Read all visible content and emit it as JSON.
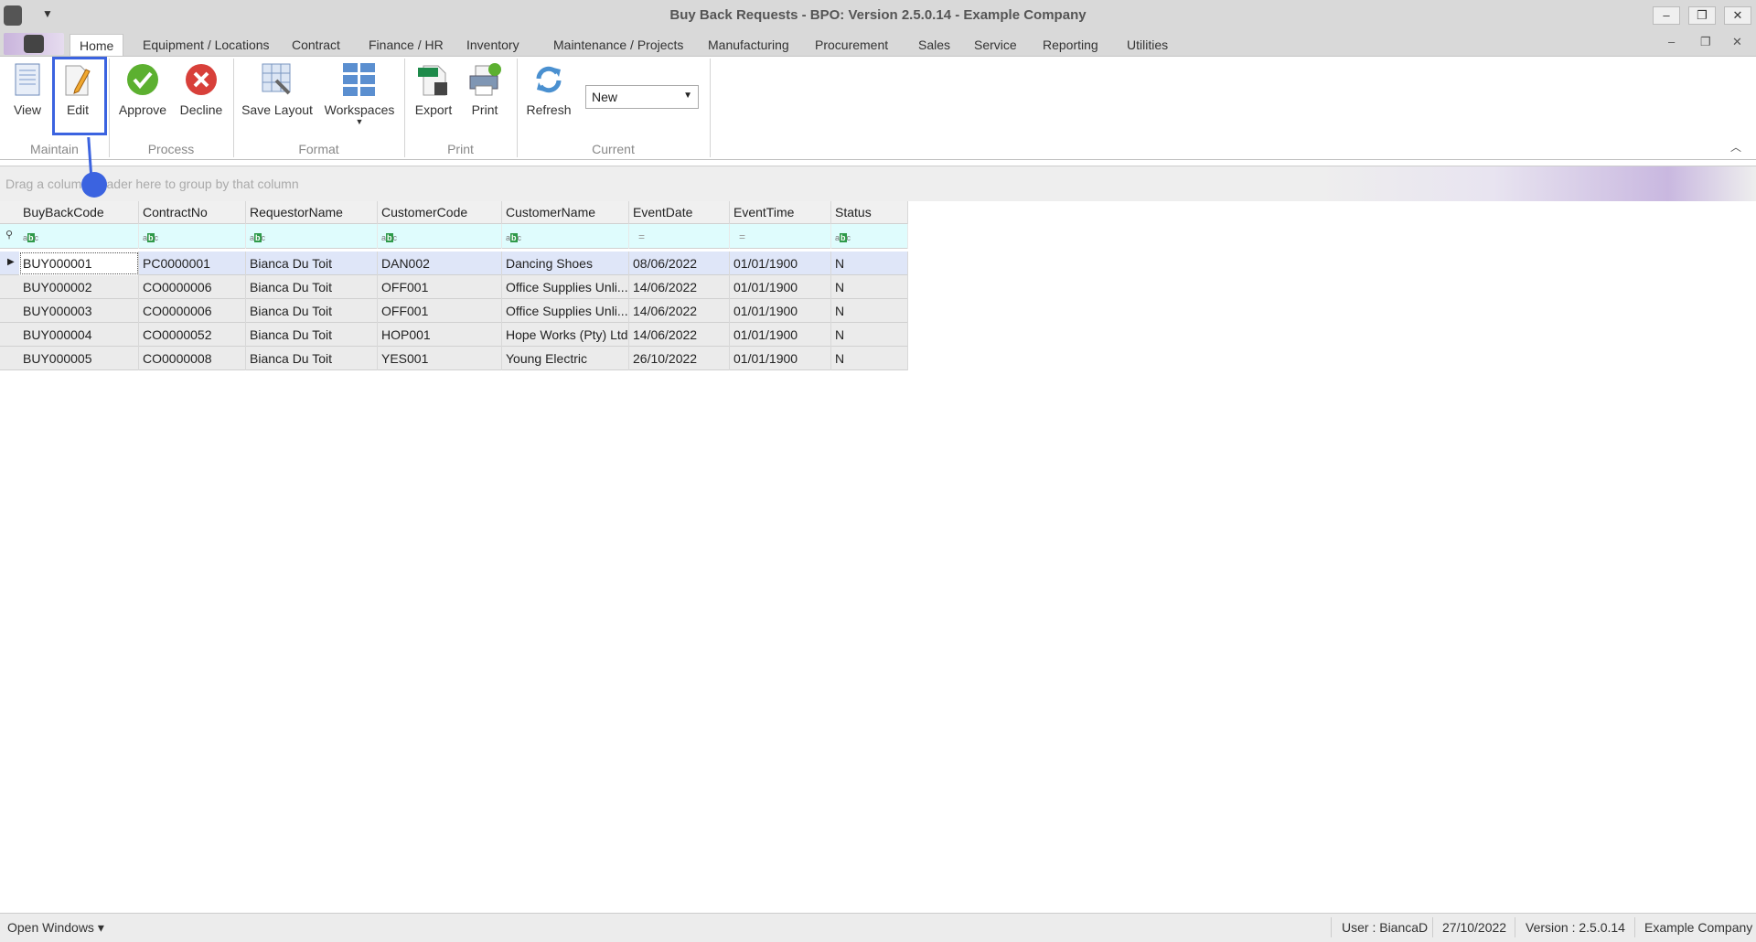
{
  "window": {
    "title": "Buy Back Requests - BPO: Version 2.5.0.14 - Example Company",
    "minimize": "–",
    "restore": "❐",
    "close": "✕"
  },
  "tabs": [
    {
      "label": "Home",
      "active": true
    },
    {
      "label": "Equipment / Locations"
    },
    {
      "label": "Contract"
    },
    {
      "label": "Finance / HR"
    },
    {
      "label": "Inventory"
    },
    {
      "label": "Maintenance / Projects"
    },
    {
      "label": "Manufacturing"
    },
    {
      "label": "Procurement"
    },
    {
      "label": "Sales"
    },
    {
      "label": "Service"
    },
    {
      "label": "Reporting"
    },
    {
      "label": "Utilities"
    }
  ],
  "ribbon": {
    "buttons": {
      "view": "View",
      "edit": "Edit",
      "approve": "Approve",
      "decline": "Decline",
      "save_layout": "Save Layout",
      "workspaces": "Workspaces",
      "export": "Export",
      "print": "Print",
      "refresh": "Refresh"
    },
    "groups": {
      "maintain": "Maintain",
      "process": "Process",
      "format": "Format",
      "print": "Print",
      "current": "Current"
    },
    "current_select": "New"
  },
  "grid": {
    "group_hint": "Drag a column header here to group by that column",
    "columns": [
      "BuyBackCode",
      "ContractNo",
      "RequestorName",
      "CustomerCode",
      "CustomerName",
      "EventDate",
      "EventTime",
      "Status"
    ],
    "rows": [
      [
        "BUY000001",
        "PC0000001",
        "Bianca Du Toit",
        "DAN002",
        "Dancing Shoes",
        "08/06/2022",
        "01/01/1900",
        "N"
      ],
      [
        "BUY000002",
        "CO0000006",
        "Bianca Du Toit",
        "OFF001",
        "Office Supplies Unli...",
        "14/06/2022",
        "01/01/1900",
        "N"
      ],
      [
        "BUY000003",
        "CO0000006",
        "Bianca Du Toit",
        "OFF001",
        "Office Supplies Unli...",
        "14/06/2022",
        "01/01/1900",
        "N"
      ],
      [
        "BUY000004",
        "CO0000052",
        "Bianca Du Toit",
        "HOP001",
        "Hope Works (Pty) Ltd",
        "14/06/2022",
        "01/01/1900",
        "N"
      ],
      [
        "BUY000005",
        "CO0000008",
        "Bianca Du Toit",
        "YES001",
        "Young Electric",
        "26/10/2022",
        "01/01/1900",
        "N"
      ]
    ],
    "selected_row": 0
  },
  "statusbar": {
    "open_windows": "Open Windows ▾",
    "user": "User : BiancaD",
    "date": "27/10/2022",
    "version": "Version : 2.5.0.14",
    "company": "Example Company"
  },
  "colors": {
    "accent": "#3b63e0",
    "filter_row": "#dffcfd",
    "selected_row": "#dfe6f8"
  }
}
